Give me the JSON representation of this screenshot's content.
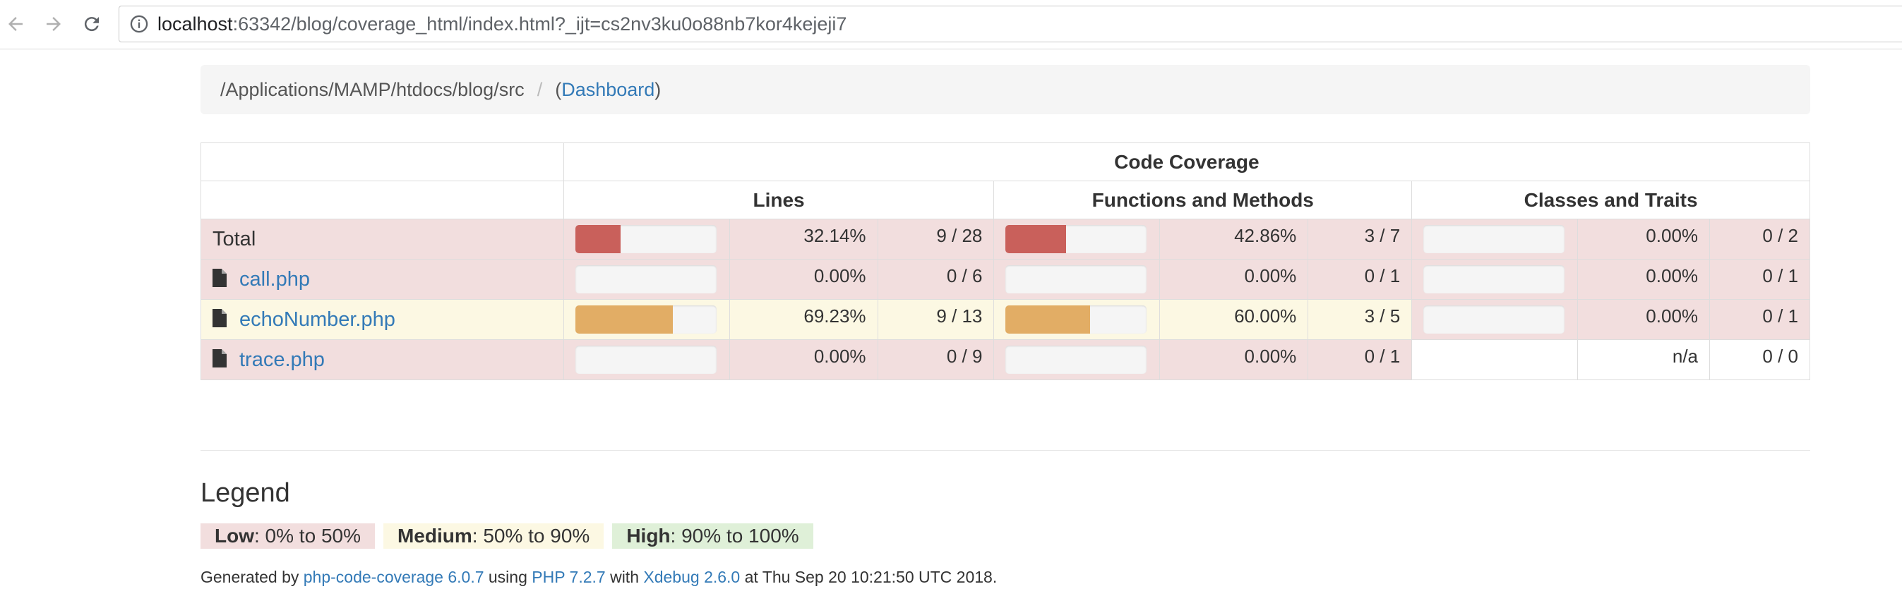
{
  "browser": {
    "url_host": "localhost",
    "url_rest": ":63342/blog/coverage_html/index.html?_ijt=cs2nv3ku0o88nb7kor4kejeji7"
  },
  "breadcrumb": {
    "path": "/Applications/MAMP/htdocs/blog/src",
    "separator": "/",
    "open_paren": "(",
    "link": "Dashboard",
    "close_paren": ")"
  },
  "table": {
    "header_main": "Code Coverage",
    "header_lines": "Lines",
    "header_functions": "Functions and Methods",
    "header_classes": "Classes and Traits",
    "rows": [
      {
        "name": "Total",
        "lines_pct": "32.14%",
        "lines_count": "9 / 28",
        "lines_fill": 32.14,
        "func_pct": "42.86%",
        "func_count": "3 / 7",
        "func_fill": 42.86,
        "class_pct": "0.00%",
        "class_count": "0 / 2",
        "class_fill": 0
      },
      {
        "name": "call.php",
        "lines_pct": "0.00%",
        "lines_count": "0 / 6",
        "lines_fill": 0,
        "func_pct": "0.00%",
        "func_count": "0 / 1",
        "func_fill": 0,
        "class_pct": "0.00%",
        "class_count": "0 / 1",
        "class_fill": 0
      },
      {
        "name": "echoNumber.php",
        "lines_pct": "69.23%",
        "lines_count": "9 / 13",
        "lines_fill": 69.23,
        "func_pct": "60.00%",
        "func_count": "3 / 5",
        "func_fill": 60.0,
        "class_pct": "0.00%",
        "class_count": "0 / 1",
        "class_fill": 0
      },
      {
        "name": "trace.php",
        "lines_pct": "0.00%",
        "lines_count": "0 / 9",
        "lines_fill": 0,
        "func_pct": "0.00%",
        "func_count": "0 / 1",
        "func_fill": 0,
        "class_pct": "n/a",
        "class_count": "0 / 0"
      }
    ]
  },
  "legend": {
    "title": "Legend",
    "low_label": "Low",
    "low_range": ": 0% to 50%",
    "medium_label": "Medium",
    "medium_range": ": 50% to 90%",
    "high_label": "High",
    "high_range": ": 90% to 100%"
  },
  "footer": {
    "generated_by": "Generated by ",
    "tool_link": "php-code-coverage 6.0.7",
    "using": " using ",
    "php_link": "PHP 7.2.7",
    "with": " with ",
    "xdebug_link": "Xdebug 2.6.0",
    "date": " at Thu Sep 20 10:21:50 UTC 2018."
  },
  "colors": {
    "low": "#f2dede",
    "medium": "#fcf8e3",
    "high": "#dff0d8",
    "bar_danger": "#c9605b",
    "bar_warning": "#e2ad65",
    "link": "#337ab7"
  }
}
